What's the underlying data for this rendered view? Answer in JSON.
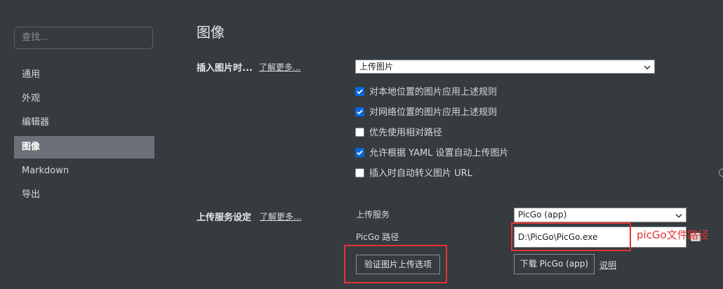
{
  "sidebar": {
    "search_placeholder": "查找...",
    "items": [
      {
        "label": "通用"
      },
      {
        "label": "外观"
      },
      {
        "label": "编辑器"
      },
      {
        "label": "图像",
        "active": true
      },
      {
        "label": "Markdown"
      },
      {
        "label": "导出"
      }
    ]
  },
  "main": {
    "title": "图像",
    "insert": {
      "label": "插入图片时...",
      "learn_more": "了解更多...",
      "select_value": "上传图片",
      "options": [
        {
          "label": "对本地位置的图片应用上述规则",
          "checked": true
        },
        {
          "label": "对网络位置的图片应用上述规则",
          "checked": true
        },
        {
          "label": "优先使用相对路径",
          "checked": false
        },
        {
          "label": "允许根据 YAML 设置自动上传图片",
          "checked": true
        },
        {
          "label": "插入时自动转义图片 URL",
          "checked": false
        }
      ]
    },
    "upload": {
      "label": "上传服务设定",
      "learn_more": "了解更多...",
      "service_label": "上传服务",
      "service_value": "PicGo (app)",
      "path_label": "PicGo 路径",
      "path_value": "D:\\PicGo\\PicGo.exe",
      "verify_button": "验证图片上传选项",
      "download_button": "下载 PicGo (app)",
      "help_link": "说明"
    },
    "annotation": "picGo文件路径"
  },
  "colors": {
    "background": "#363b40",
    "sidebar_active": "#6d7079",
    "checkbox_checked": "#0a66d8",
    "annotation_red": "#e53333"
  }
}
